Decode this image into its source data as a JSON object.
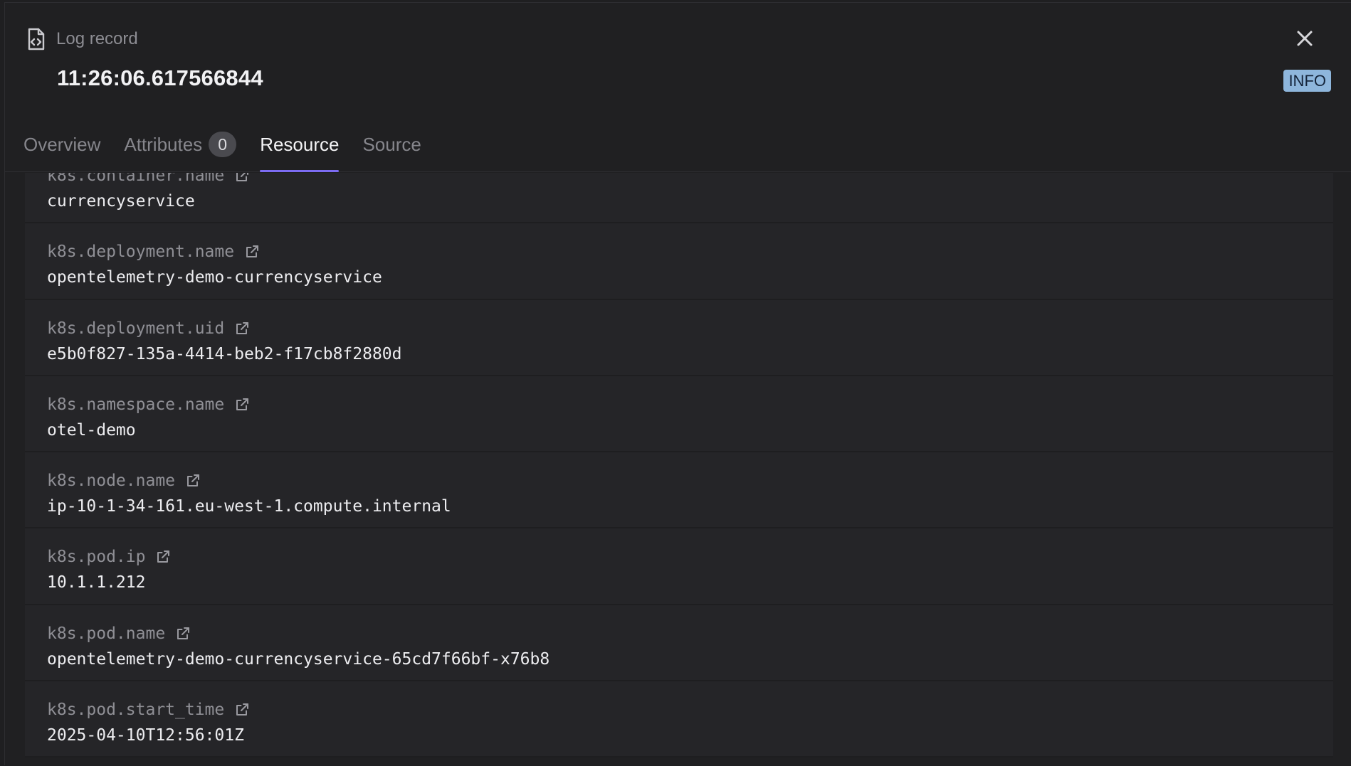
{
  "header": {
    "label": "Log record",
    "timestamp": "11:26:06.617566844",
    "level": "INFO"
  },
  "tabs": [
    {
      "label": "Overview",
      "active": false
    },
    {
      "label": "Attributes",
      "count": "0",
      "active": false
    },
    {
      "label": "Resource",
      "active": true
    },
    {
      "label": "Source",
      "active": false
    }
  ],
  "resource": [
    {
      "key": "k8s.container.name",
      "value": "currencyservice"
    },
    {
      "key": "k8s.deployment.name",
      "value": "opentelemetry-demo-currencyservice"
    },
    {
      "key": "k8s.deployment.uid",
      "value": "e5b0f827-135a-4414-beb2-f17cb8f2880d"
    },
    {
      "key": "k8s.namespace.name",
      "value": "otel-demo"
    },
    {
      "key": "k8s.node.name",
      "value": "ip-10-1-34-161.eu-west-1.compute.internal"
    },
    {
      "key": "k8s.pod.ip",
      "value": "10.1.1.212"
    },
    {
      "key": "k8s.pod.name",
      "value": "opentelemetry-demo-currencyservice-65cd7f66bf-x76b8"
    },
    {
      "key": "k8s.pod.start_time",
      "value": "2025-04-10T12:56:01Z"
    }
  ],
  "colors": {
    "background": "#202022",
    "accent": "#7c6cf2",
    "info_badge": "#8eb6dc"
  },
  "icons": {
    "header": "document-code-icon",
    "close": "close-icon",
    "row_link": "external-link-icon"
  }
}
